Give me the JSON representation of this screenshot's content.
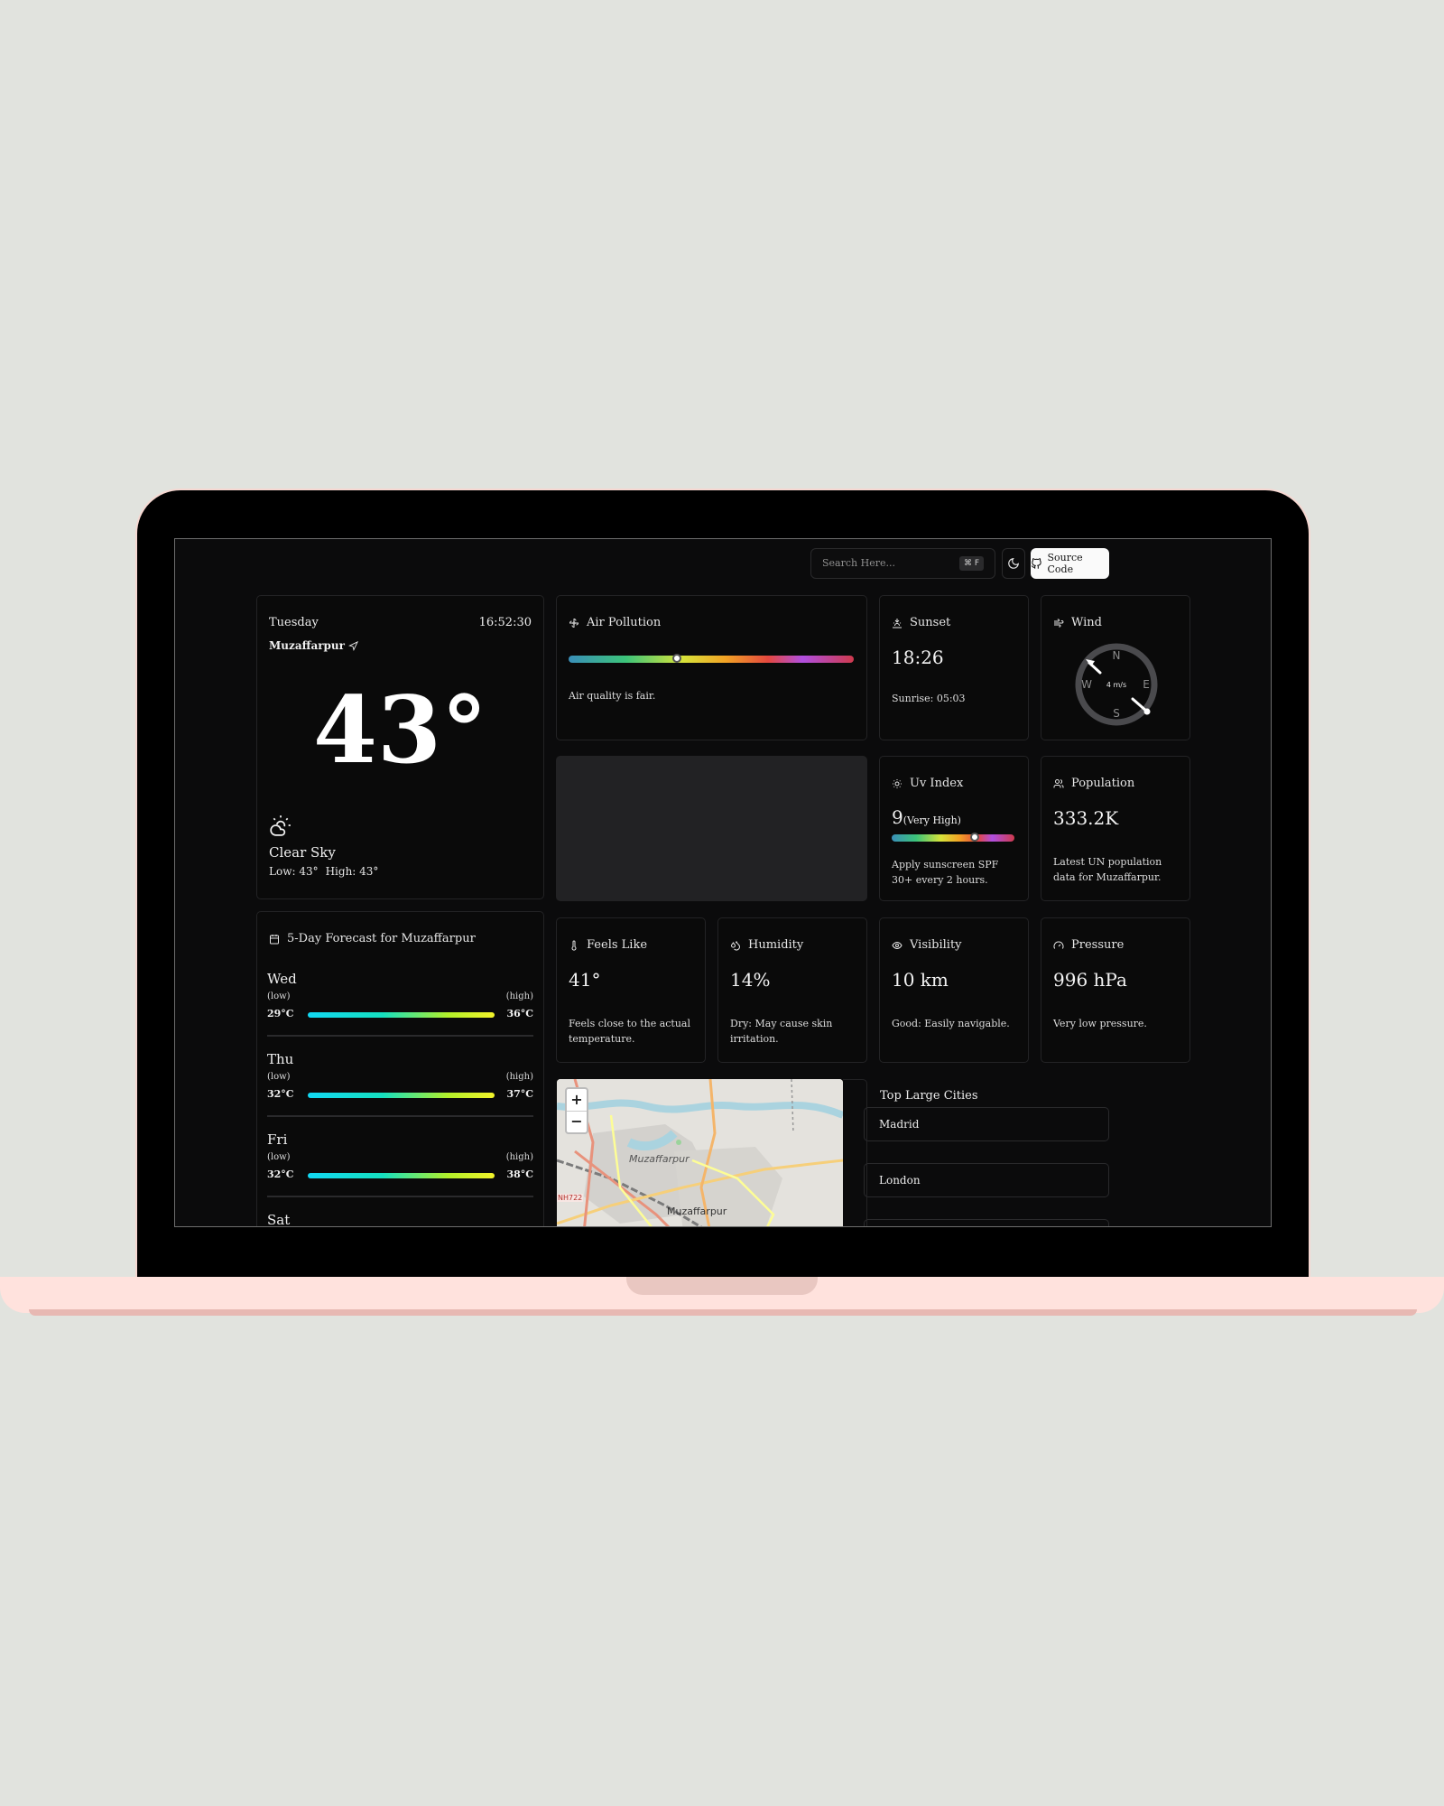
{
  "toolbar": {
    "search_placeholder": "Search Here...",
    "shortcut": "⌘ F",
    "source_label": "Source Code"
  },
  "current": {
    "day": "Tuesday",
    "time": "16:52:30",
    "city": "Muzaffarpur",
    "temperature": "43°",
    "condition": "Clear Sky",
    "low": "Low: 43°",
    "high": "High: 43°"
  },
  "air_pollution": {
    "title": "Air Pollution",
    "desc": "Air quality is fair.",
    "level_fraction": 0.38
  },
  "sunset": {
    "title": "Sunset",
    "value": "18:26",
    "sunrise": "Sunrise: 05:03"
  },
  "wind": {
    "title": "Wind",
    "speed": "4 m/s",
    "directions": {
      "n": "N",
      "s": "S",
      "e": "E",
      "w": "W"
    }
  },
  "uv": {
    "title": "Uv Index",
    "value": "9",
    "label": "(Very High)",
    "desc": "Apply sunscreen SPF 30+ every 2 hours.",
    "level_fraction": 0.68
  },
  "population": {
    "title": "Population",
    "value": "333.2K",
    "desc": "Latest UN population data for Muzaffarpur."
  },
  "feels_like": {
    "title": "Feels Like",
    "value": "41°",
    "desc": "Feels close to the actual temperature."
  },
  "humidity": {
    "title": "Humidity",
    "value": "14%",
    "desc": "Dry: May cause skin irritation."
  },
  "visibility": {
    "title": "Visibility",
    "value": "10 km",
    "desc": "Good: Easily navigable."
  },
  "pressure": {
    "title": "Pressure",
    "value": "996 hPa",
    "desc": "Very low pressure."
  },
  "forecast": {
    "title": "5-Day Forecast for Muzaffarpur",
    "low_label": "(low)",
    "high_label": "(high)",
    "days": [
      {
        "day": "Wed",
        "low": "29°C",
        "high": "36°C"
      },
      {
        "day": "Thu",
        "low": "32°C",
        "high": "37°C"
      },
      {
        "day": "Fri",
        "low": "32°C",
        "high": "38°C"
      },
      {
        "day": "Sat"
      }
    ]
  },
  "map": {
    "zoom_in": "+",
    "zoom_out": "−",
    "labels": [
      "Muzaffarpur",
      "Muzaffarpur",
      "NH722"
    ]
  },
  "cities": {
    "title": "Top Large Cities",
    "items": [
      "Madrid",
      "London"
    ]
  }
}
